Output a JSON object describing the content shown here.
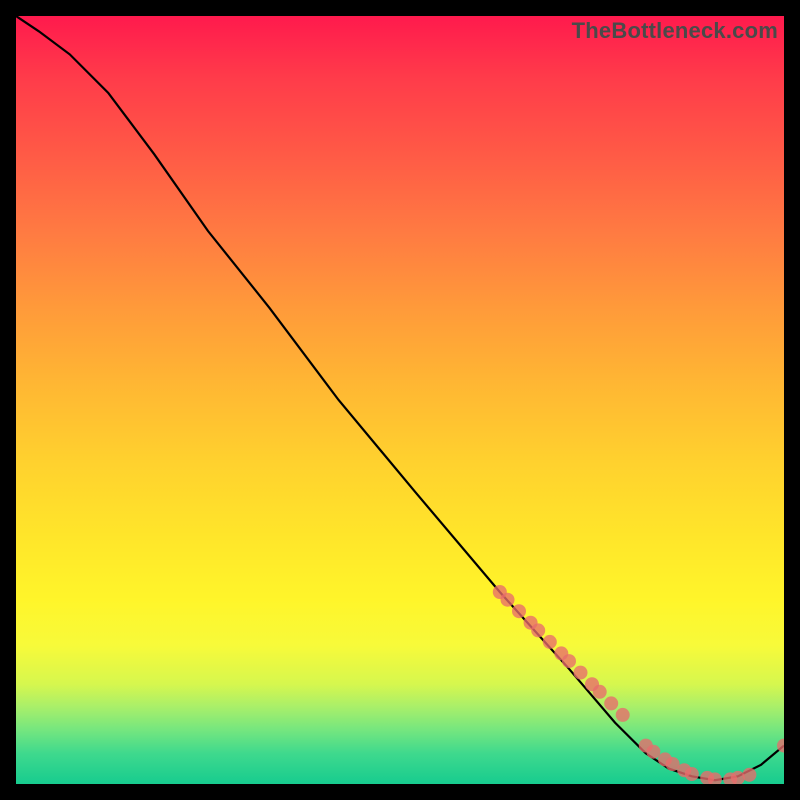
{
  "watermark": "TheBottleneck.com",
  "colors": {
    "background": "#000000",
    "line": "#000000",
    "marker": "#e86b6b"
  },
  "chart_data": {
    "type": "line",
    "title": "",
    "xlabel": "",
    "ylabel": "",
    "xlim": [
      0,
      100
    ],
    "ylim": [
      0,
      100
    ],
    "grid": false,
    "series": [
      {
        "name": "curve",
        "x": [
          0,
          3,
          7,
          12,
          18,
          25,
          33,
          42,
          52,
          63,
          72,
          78,
          82,
          85,
          88,
          91,
          94,
          97,
          100
        ],
        "y": [
          100,
          98,
          95,
          90,
          82,
          72,
          62,
          50,
          38,
          25,
          15,
          8,
          4,
          2,
          1,
          0.5,
          1,
          2.5,
          5
        ]
      }
    ],
    "markers": {
      "name": "highlighted-points",
      "x": [
        63,
        64,
        65.5,
        67,
        68,
        69.5,
        71,
        72,
        73.5,
        75,
        76,
        77.5,
        79,
        82,
        83,
        84.5,
        85.5,
        87,
        88,
        90,
        91,
        93,
        94,
        95.5,
        100
      ],
      "y": [
        25,
        24,
        22.5,
        21,
        20,
        18.5,
        17,
        16,
        14.5,
        13,
        12,
        10.5,
        9,
        5,
        4.2,
        3.2,
        2.6,
        1.8,
        1.3,
        0.8,
        0.6,
        0.6,
        0.8,
        1.2,
        5
      ]
    }
  }
}
